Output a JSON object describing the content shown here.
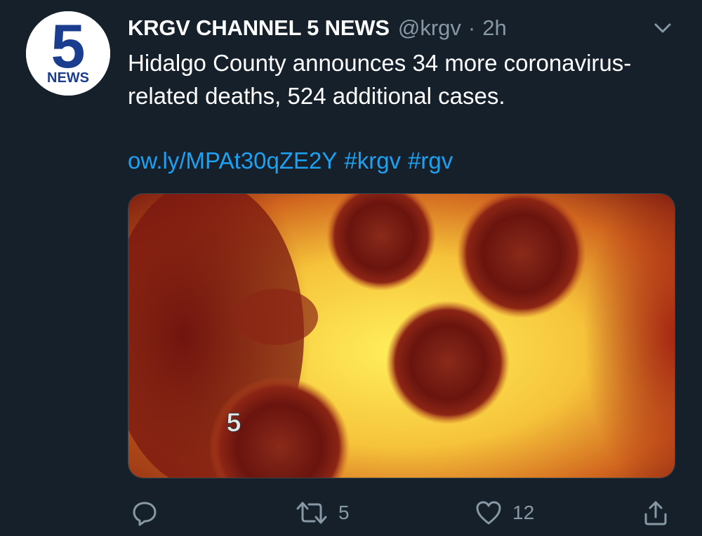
{
  "tweet": {
    "display_name": "KRGV CHANNEL 5 NEWS",
    "handle": "@krgv",
    "separator": "·",
    "time": "2h",
    "avatar": {
      "logo_number": "5",
      "logo_text": "NEWS",
      "icon": "news-logo-icon"
    },
    "text": "Hidalgo County announces 34 more coronavirus-related deaths, 524 additional cases.",
    "link": "ow.ly/MPAt30qZE2Y",
    "hashtags": [
      "#krgv",
      "#rgv"
    ],
    "media": {
      "icon": "virus-image",
      "watermark": "5"
    }
  },
  "actions": {
    "reply": {
      "icon": "reply-icon"
    },
    "retweet": {
      "icon": "retweet-icon",
      "count": "5"
    },
    "like": {
      "icon": "heart-icon",
      "count": "12"
    },
    "share": {
      "icon": "share-icon"
    }
  },
  "colors": {
    "background": "#15202b",
    "primary_text": "#ffffff",
    "secondary_text": "#8899a6",
    "link": "#1da1f2",
    "logo_blue": "#1b3d8f"
  }
}
